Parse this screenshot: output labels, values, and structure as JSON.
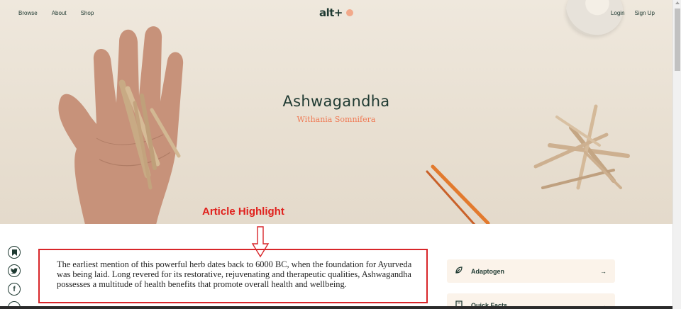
{
  "nav": {
    "left": [
      "Browse",
      "About",
      "Shop"
    ],
    "logo": "alt+",
    "login": "Login",
    "signup": "Sign Up"
  },
  "hero": {
    "title": "Ashwagandha",
    "subtitle": "Withania Somnifera"
  },
  "annotation": {
    "label": "Article Highlight"
  },
  "article": {
    "text": "The earliest mention of this powerful herb dates back to 6000 BC, when the foundation for Ayurveda was being laid. Long revered for its restorative, rejuvenating and therapeutic qualities, Ashwagandha possesses a multitude of health benefits that promote overall health and wellbeing."
  },
  "social": {
    "bookmark": "bookmark-icon",
    "twitter": "twitter-icon",
    "facebook": "facebook-icon"
  },
  "sidebar_cards": [
    {
      "label": "Adaptogen",
      "icon": "leaf-icon",
      "arrow": "→"
    },
    {
      "label": "Quick Facts",
      "icon": "book-icon",
      "arrow": "→"
    }
  ],
  "colors": {
    "brand": "#1f3a32",
    "accent": "#ef7a55",
    "hero_bg": "#ebe3d6",
    "annotation": "#e0211d",
    "card_bg": "#fbf3ea"
  }
}
